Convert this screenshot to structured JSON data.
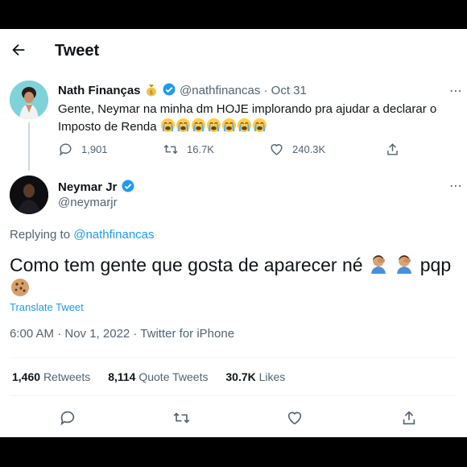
{
  "header": {
    "title": "Tweet"
  },
  "quoted_tweet": {
    "name": "Nath Finanças",
    "handle": "@nathfinancas",
    "date": "· Oct 31",
    "text": "Gente, Neymar na minha dm HOJE implorando pra ajudar a declarar o Imposto de Renda",
    "emoji_count": 7,
    "replies": "1,901",
    "retweets": "16.7K",
    "likes": "240.3K"
  },
  "main_tweet": {
    "name": "Neymar Jr",
    "handle": "@neymarjr",
    "replying_prefix": "Replying to ",
    "replying_to": "@nathfinancas",
    "text": "Como tem gente que gosta de aparecer né",
    "text_suffix": "pqp",
    "translate": "Translate Tweet",
    "timestamp": "6:00 AM · Nov 1, 2022 · Twitter for iPhone",
    "retweets_count": "1,460",
    "retweets_label": "Retweets",
    "quotes_count": "8,114",
    "quotes_label": "Quote Tweets",
    "likes_count": "30.7K",
    "likes_label": "Likes"
  },
  "colors": {
    "accent": "#1d9bf0",
    "muted": "#536471",
    "text": "#0f1419"
  },
  "icons": [
    "back-arrow-icon",
    "verified-icon",
    "money-bag-icon",
    "crying-face-icon",
    "facepalm-icon",
    "cookie-icon",
    "reply-icon",
    "retweet-icon",
    "like-icon",
    "share-icon",
    "more-icon"
  ]
}
